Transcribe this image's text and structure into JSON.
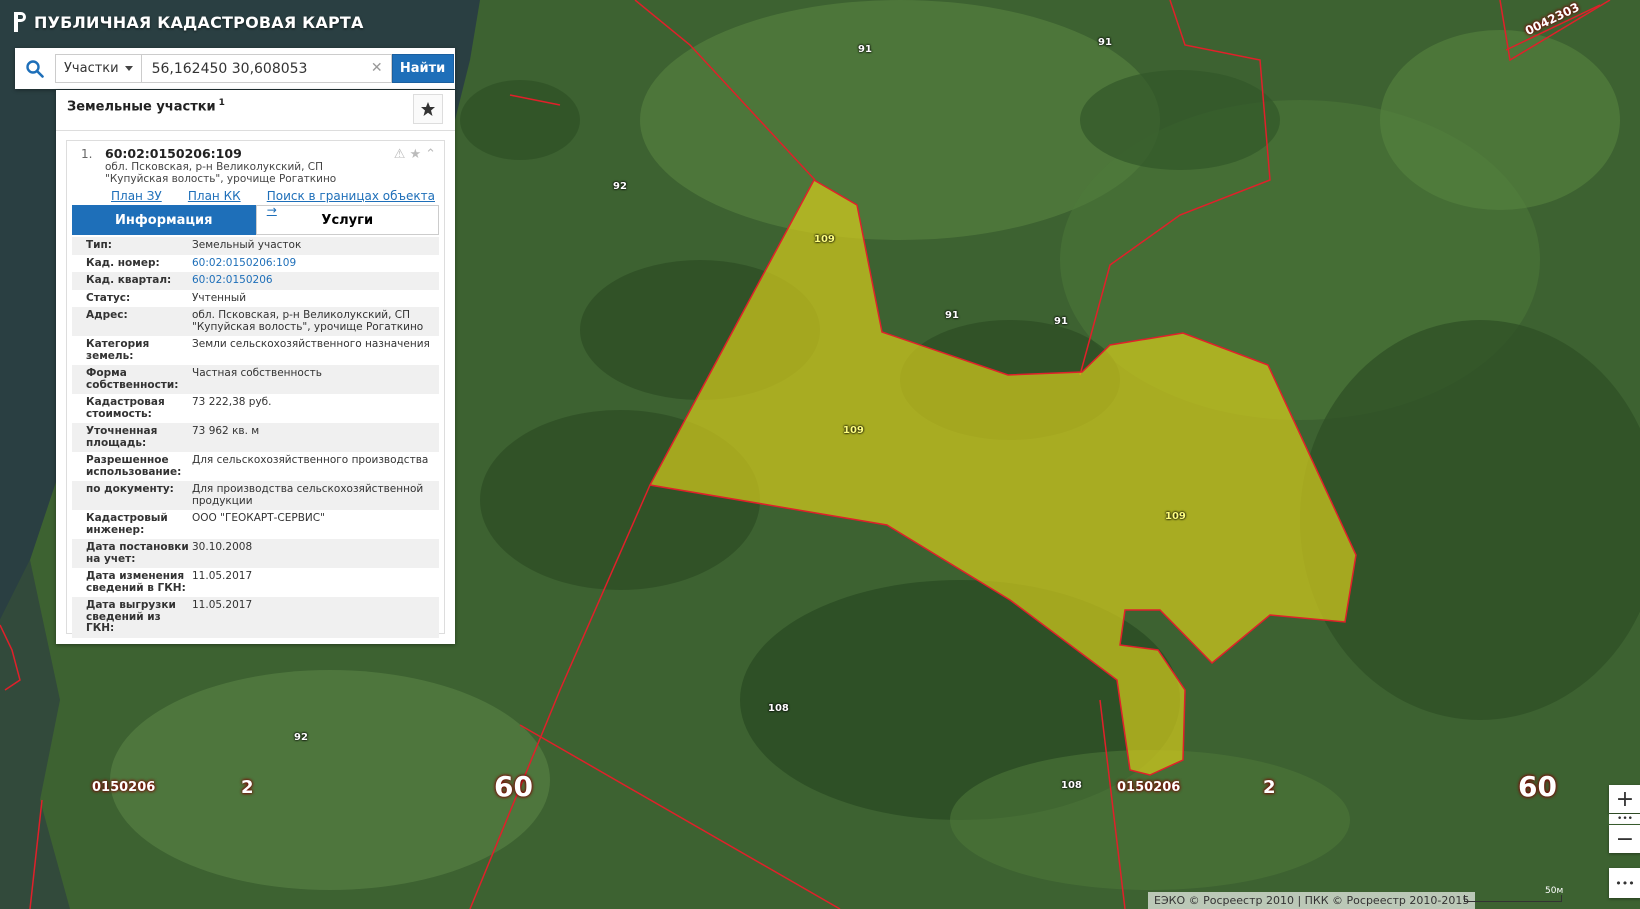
{
  "app": {
    "title": "ПУБЛИЧНАЯ КАДАСТРОВАЯ КАРТА"
  },
  "search": {
    "category": "Участки",
    "query": "56,162450 30,608053",
    "button": "Найти"
  },
  "panel": {
    "title": "Земельные участки",
    "count": "1",
    "result": {
      "index": "1.",
      "cad_number": "60:02:0150206:109",
      "address": "обл. Псковская, р-н Великолукский, СП \"Купуйская волость\", урочище Рогаткино",
      "links": [
        "План ЗУ →",
        "План КК →",
        "Поиск в границах объекта →"
      ],
      "tabs": [
        "Информация",
        "Услуги"
      ],
      "fields": [
        {
          "k": "Тип:",
          "v": "Земельный участок"
        },
        {
          "k": "Кад. номер:",
          "v": "60:02:0150206:109",
          "link": true
        },
        {
          "k": "Кад. квартал:",
          "v": "60:02:0150206",
          "link": true
        },
        {
          "k": "Статус:",
          "v": "Учтенный"
        },
        {
          "k": "Адрес:",
          "v": "обл. Псковская, р-н Великолукский, СП \"Купуйская волость\", урочище Рогаткино"
        },
        {
          "k": "Категория земель:",
          "v": "Земли сельскохозяйственного назначения"
        },
        {
          "k": "Форма собственности:",
          "v": "Частная собственность"
        },
        {
          "k": "Кадастровая стоимость:",
          "v": "73 222,38 руб."
        },
        {
          "k": "Уточненная площадь:",
          "v": "73 962 кв. м"
        },
        {
          "k": "Разрешенное использование:",
          "v": "Для сельскохозяйственного производства"
        },
        {
          "k": "по документу:",
          "v": "Для производства сельскохозяйственной продукции"
        },
        {
          "k": "Кадастровый инженер:",
          "v": "ООО \"ГЕОКАРТ-СЕРВИС\""
        },
        {
          "k": "Дата постановки на учет:",
          "v": "30.10.2008"
        },
        {
          "k": "Дата изменения сведений в ГКН:",
          "v": "11.05.2017"
        },
        {
          "k": "Дата выгрузки сведений из ГКН:",
          "v": "11.05.2017"
        }
      ]
    }
  },
  "map": {
    "parcel_labels": [
      "109",
      "109",
      "109",
      "91",
      "91",
      "91",
      "91",
      "92",
      "92",
      "108",
      "108"
    ],
    "block_labels": [
      "0150206",
      "2",
      "60",
      "0150206",
      "2",
      "60"
    ],
    "corner_label": "0042303",
    "zoom_in": "+",
    "zoom_out": "−",
    "more": "•••",
    "attribution": "ЕЭКО © Росреестр 2010 | ПКК © Росреестр 2010-2015",
    "scale": "50м",
    "colors": {
      "parcel_fill": "#d6cc1c",
      "boundary": "#e0202a",
      "primary": "#1e6fb9"
    }
  }
}
